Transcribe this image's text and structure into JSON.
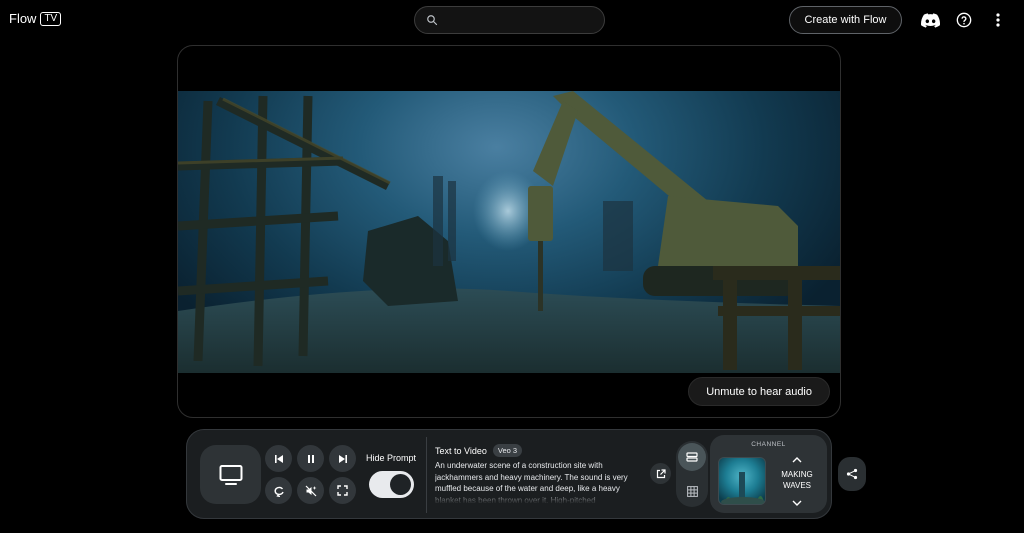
{
  "header": {
    "logo_text": "Flow",
    "logo_badge": "TV",
    "search": {
      "placeholder": "",
      "value": ""
    },
    "create_button": "Create with Flow",
    "icons": [
      "discord-icon",
      "help-icon",
      "more-vert-icon"
    ]
  },
  "player": {
    "unmute_label": "Unmute to hear audio"
  },
  "controls": {
    "hide_prompt_label": "Hide Prompt",
    "hide_prompt_enabled": true,
    "prompt_mode": "Text to Video",
    "model_badge": "Veo 3",
    "prompt_text": "An underwater scene of a construction site with jackhammers and heavy machinery. The sound is very muffled because of the water and deep, like a heavy blanket has been thrown over it. High-pitched",
    "channel_label": "CHANNEL",
    "channel_name_line1": "MAKING",
    "channel_name_line2": "WAVES"
  },
  "colors": {
    "background": "#000000",
    "panel": "#1b1e20",
    "water": "#1a4a66"
  }
}
